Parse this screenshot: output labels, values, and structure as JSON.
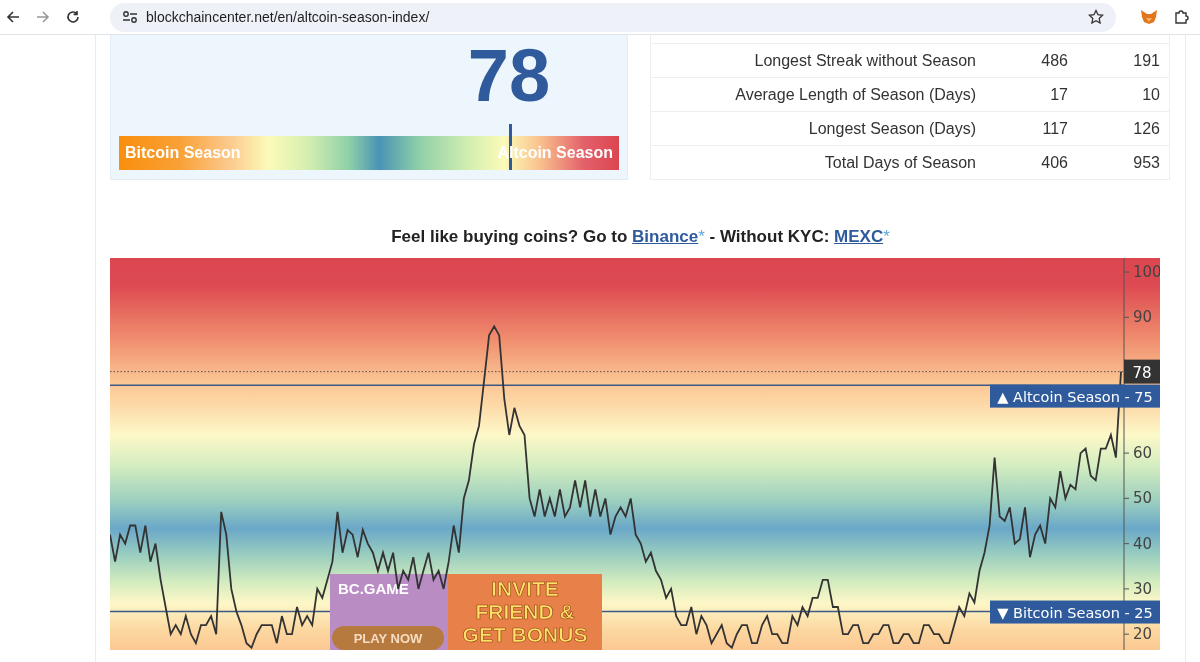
{
  "browser": {
    "url": "blockchaincenter.net/en/altcoin-season-index/"
  },
  "index": {
    "value": "78",
    "level": 0.78,
    "left_label": "Bitcoin Season",
    "right_label": "Altcoin Season"
  },
  "stats": [
    {
      "label": "Longest Streak without Season",
      "column_2": "486",
      "column_3": "191"
    },
    {
      "label": "Average Length of Season (Days)",
      "column_2": "17",
      "column_3": "10"
    },
    {
      "label": "Longest Season (Days)",
      "column_2": "117",
      "column_3": "126"
    },
    {
      "label": "Total Days of Season",
      "column_2": "406",
      "column_3": "953"
    }
  ],
  "promo": [
    {
      "kind": "text",
      "text": "Feel like buying coins? Go to "
    },
    {
      "kind": "link",
      "text": "Binance",
      "note": "*"
    },
    {
      "kind": "text",
      "text": " - Without KYC: "
    },
    {
      "kind": "link",
      "text": "MEXC",
      "note": "*"
    }
  ],
  "chart": {
    "chart_data": {
      "type": "line",
      "ylim": [
        16.5,
        103.1
      ],
      "yticks": [
        20,
        30,
        40,
        50,
        60,
        90,
        100
      ],
      "series": [
        {
          "color": "#333333",
          "values": [
            42,
            36,
            42,
            40,
            44,
            44,
            38,
            44,
            36,
            40,
            32,
            26,
            20,
            22,
            20,
            24,
            20,
            18,
            22,
            22,
            24,
            20,
            47,
            42,
            30,
            25,
            22,
            18,
            17,
            20,
            22,
            22,
            22,
            18,
            24,
            20,
            20,
            26,
            22,
            24,
            22,
            30,
            28,
            32,
            36,
            47,
            38,
            43,
            42,
            37,
            43,
            40,
            38,
            34,
            38,
            34,
            38,
            30,
            34,
            32,
            37,
            30,
            34,
            38,
            32,
            34,
            30,
            36,
            44,
            38,
            50,
            54,
            62,
            66,
            76,
            86,
            88,
            86,
            72,
            64,
            70,
            66,
            64,
            50,
            46,
            52,
            46,
            50,
            46,
            52,
            46,
            48,
            54,
            48,
            54,
            46,
            52,
            46,
            50,
            42,
            46,
            48,
            46,
            50,
            42,
            40,
            36,
            38,
            34,
            32,
            28,
            30,
            24,
            22,
            22,
            26,
            20,
            24,
            22,
            18,
            20,
            22,
            18,
            17,
            20,
            22,
            22,
            18,
            18,
            22,
            24,
            20,
            20,
            18,
            18,
            24,
            22,
            26,
            24,
            28,
            28,
            32,
            32,
            26,
            26,
            20,
            20,
            22,
            22,
            18,
            18,
            20,
            20,
            22,
            22,
            18,
            18,
            20,
            20,
            18,
            18,
            22,
            22,
            20,
            20,
            18,
            18,
            22,
            26,
            24,
            29,
            27,
            34,
            38,
            44,
            59,
            46,
            45,
            48,
            40,
            41,
            48,
            37,
            42,
            44,
            40,
            50,
            48,
            56,
            50,
            53,
            52,
            60,
            61,
            55,
            54,
            61,
            61,
            64,
            59,
            78
          ]
        }
      ],
      "ref_lines": [
        {
          "axis": "y",
          "value": 78,
          "label": "78"
        },
        {
          "axis": "y",
          "value": 75,
          "label": "▲ Altcoin Season - 75"
        },
        {
          "axis": "y",
          "value": 25,
          "label": "▼ Bitcoin Season - 25"
        }
      ]
    }
  },
  "ad": {
    "brand": "BC.GAME",
    "headline": [
      "INVITE",
      "FRIEND &",
      "GET BONUS"
    ],
    "button": "PLAY NOW"
  }
}
